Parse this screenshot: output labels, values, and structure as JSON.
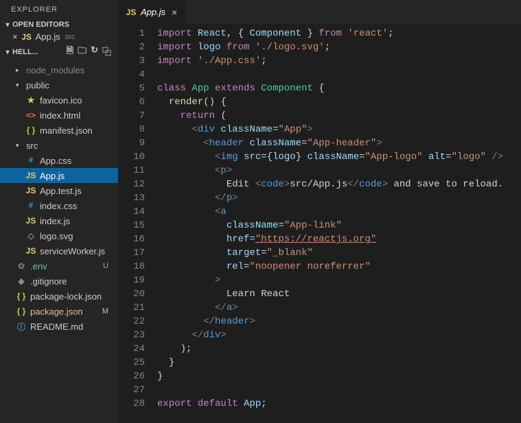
{
  "explorer": {
    "title": "EXPLORER",
    "openEditors": {
      "label": "OPEN EDITORS",
      "items": [
        {
          "icon": "JS",
          "name": "App.js",
          "path": "src"
        }
      ]
    },
    "project": {
      "label": "HELL...",
      "tree": [
        {
          "depth": 0,
          "type": "folder",
          "expanded": false,
          "name": "node_modules",
          "dim": true
        },
        {
          "depth": 0,
          "type": "folder",
          "expanded": true,
          "name": "public"
        },
        {
          "depth": 1,
          "type": "file",
          "icon": "star",
          "name": "favicon.ico"
        },
        {
          "depth": 1,
          "type": "file",
          "icon": "html",
          "name": "index.html"
        },
        {
          "depth": 1,
          "type": "file",
          "icon": "json",
          "name": "manifest.json"
        },
        {
          "depth": 0,
          "type": "folder",
          "expanded": true,
          "name": "src"
        },
        {
          "depth": 1,
          "type": "file",
          "icon": "css",
          "name": "App.css"
        },
        {
          "depth": 1,
          "type": "file",
          "icon": "js",
          "name": "App.js",
          "active": true
        },
        {
          "depth": 1,
          "type": "file",
          "icon": "js",
          "name": "App.test.js"
        },
        {
          "depth": 1,
          "type": "file",
          "icon": "css",
          "name": "index.css"
        },
        {
          "depth": 1,
          "type": "file",
          "icon": "js",
          "name": "index.js"
        },
        {
          "depth": 1,
          "type": "file",
          "icon": "svg",
          "name": "logo.svg"
        },
        {
          "depth": 1,
          "type": "file",
          "icon": "js",
          "name": "serviceWorker.js"
        },
        {
          "depth": 0,
          "type": "file",
          "icon": "gear",
          "name": ".env",
          "git": "U"
        },
        {
          "depth": 0,
          "type": "file",
          "icon": "dot",
          "name": ".gitignore"
        },
        {
          "depth": 0,
          "type": "file",
          "icon": "json",
          "name": "package-lock.json"
        },
        {
          "depth": 0,
          "type": "file",
          "icon": "json",
          "name": "package.json",
          "git": "M"
        },
        {
          "depth": 0,
          "type": "file",
          "icon": "md",
          "name": "README.md"
        }
      ]
    }
  },
  "tabs": [
    {
      "icon": "JS",
      "name": "App.js"
    }
  ],
  "code": {
    "lines": [
      [
        [
          "kw",
          "import"
        ],
        [
          "",
          " "
        ],
        [
          "var",
          "React"
        ],
        [
          "",
          ", "
        ],
        [
          "bracket",
          "{"
        ],
        [
          "",
          " "
        ],
        [
          "var",
          "Component"
        ],
        [
          "",
          " "
        ],
        [
          "bracket",
          "}"
        ],
        [
          "",
          " "
        ],
        [
          "kw",
          "from"
        ],
        [
          "",
          " "
        ],
        [
          "str",
          "'react'"
        ],
        [
          "",
          ";"
        ]
      ],
      [
        [
          "kw",
          "import"
        ],
        [
          "",
          " "
        ],
        [
          "var",
          "logo"
        ],
        [
          "",
          " "
        ],
        [
          "kw",
          "from"
        ],
        [
          "",
          " "
        ],
        [
          "str",
          "'./logo.svg'"
        ],
        [
          "",
          ";"
        ]
      ],
      [
        [
          "kw",
          "import"
        ],
        [
          "",
          " "
        ],
        [
          "str",
          "'./App.css'"
        ],
        [
          "",
          ";"
        ]
      ],
      [
        [
          "",
          ""
        ]
      ],
      [
        [
          "kw",
          "class"
        ],
        [
          "",
          " "
        ],
        [
          "type",
          "App"
        ],
        [
          "",
          " "
        ],
        [
          "kw",
          "extends"
        ],
        [
          "",
          " "
        ],
        [
          "type",
          "Component"
        ],
        [
          "",
          " "
        ],
        [
          "bracket",
          "{"
        ]
      ],
      [
        [
          "",
          "  "
        ],
        [
          "fn",
          "render"
        ],
        [
          "bracket",
          "()"
        ],
        [
          "",
          " "
        ],
        [
          "bracket",
          "{"
        ]
      ],
      [
        [
          "",
          "    "
        ],
        [
          "kw",
          "return"
        ],
        [
          "",
          " "
        ],
        [
          "bracket",
          "("
        ]
      ],
      [
        [
          "",
          "      "
        ],
        [
          "punct",
          "<"
        ],
        [
          "tag",
          "div"
        ],
        [
          "",
          " "
        ],
        [
          "attr",
          "className"
        ],
        [
          "",
          "="
        ],
        [
          "str",
          "\"App\""
        ],
        [
          "punct",
          ">"
        ]
      ],
      [
        [
          "",
          "        "
        ],
        [
          "punct",
          "<"
        ],
        [
          "tag",
          "header"
        ],
        [
          "",
          " "
        ],
        [
          "attr",
          "className"
        ],
        [
          "",
          "="
        ],
        [
          "str",
          "\"App-header\""
        ],
        [
          "punct",
          ">"
        ]
      ],
      [
        [
          "",
          "          "
        ],
        [
          "punct",
          "<"
        ],
        [
          "tag",
          "img"
        ],
        [
          "",
          " "
        ],
        [
          "attr",
          "src"
        ],
        [
          "",
          "="
        ],
        [
          "bracket",
          "{"
        ],
        [
          "var",
          "logo"
        ],
        [
          "bracket",
          "}"
        ],
        [
          "",
          " "
        ],
        [
          "attr",
          "className"
        ],
        [
          "",
          "="
        ],
        [
          "str",
          "\"App-logo\""
        ],
        [
          "",
          " "
        ],
        [
          "attr",
          "alt"
        ],
        [
          "",
          "="
        ],
        [
          "str",
          "\"logo\""
        ],
        [
          "",
          " "
        ],
        [
          "punct",
          "/>"
        ]
      ],
      [
        [
          "",
          "          "
        ],
        [
          "punct",
          "<"
        ],
        [
          "tag",
          "p"
        ],
        [
          "punct",
          ">"
        ]
      ],
      [
        [
          "",
          "            Edit "
        ],
        [
          "punct",
          "<"
        ],
        [
          "tag",
          "code"
        ],
        [
          "punct",
          ">"
        ],
        [
          "",
          "src/App.js"
        ],
        [
          "punct",
          "</"
        ],
        [
          "tag",
          "code"
        ],
        [
          "punct",
          ">"
        ],
        [
          "",
          " and save to reload."
        ]
      ],
      [
        [
          "",
          "          "
        ],
        [
          "punct",
          "</"
        ],
        [
          "tag",
          "p"
        ],
        [
          "punct",
          ">"
        ]
      ],
      [
        [
          "",
          "          "
        ],
        [
          "punct",
          "<"
        ],
        [
          "tag",
          "a"
        ]
      ],
      [
        [
          "",
          "            "
        ],
        [
          "attr",
          "className"
        ],
        [
          "",
          "="
        ],
        [
          "str",
          "\"App-link\""
        ]
      ],
      [
        [
          "",
          "            "
        ],
        [
          "attr",
          "href"
        ],
        [
          "",
          "="
        ],
        [
          "url",
          "\"https://reactjs.org\""
        ]
      ],
      [
        [
          "",
          "            "
        ],
        [
          "attr",
          "target"
        ],
        [
          "",
          "="
        ],
        [
          "str",
          "\"_blank\""
        ]
      ],
      [
        [
          "",
          "            "
        ],
        [
          "attr",
          "rel"
        ],
        [
          "",
          "="
        ],
        [
          "str",
          "\"noopener noreferrer\""
        ]
      ],
      [
        [
          "",
          "          "
        ],
        [
          "punct",
          ">"
        ]
      ],
      [
        [
          "",
          "            Learn React"
        ]
      ],
      [
        [
          "",
          "          "
        ],
        [
          "punct",
          "</"
        ],
        [
          "tag",
          "a"
        ],
        [
          "punct",
          ">"
        ]
      ],
      [
        [
          "",
          "        "
        ],
        [
          "punct",
          "</"
        ],
        [
          "tag",
          "header"
        ],
        [
          "punct",
          ">"
        ]
      ],
      [
        [
          "",
          "      "
        ],
        [
          "punct",
          "</"
        ],
        [
          "tag",
          "div"
        ],
        [
          "punct",
          ">"
        ]
      ],
      [
        [
          "",
          "    "
        ],
        [
          "bracket",
          ")"
        ],
        [
          "",
          ";"
        ]
      ],
      [
        [
          "",
          "  "
        ],
        [
          "bracket",
          "}"
        ]
      ],
      [
        [
          "bracket",
          "}"
        ]
      ],
      [
        [
          "",
          ""
        ]
      ],
      [
        [
          "kw",
          "export"
        ],
        [
          "",
          " "
        ],
        [
          "kw",
          "default"
        ],
        [
          "",
          " "
        ],
        [
          "var",
          "App"
        ],
        [
          "",
          ";"
        ]
      ]
    ]
  }
}
